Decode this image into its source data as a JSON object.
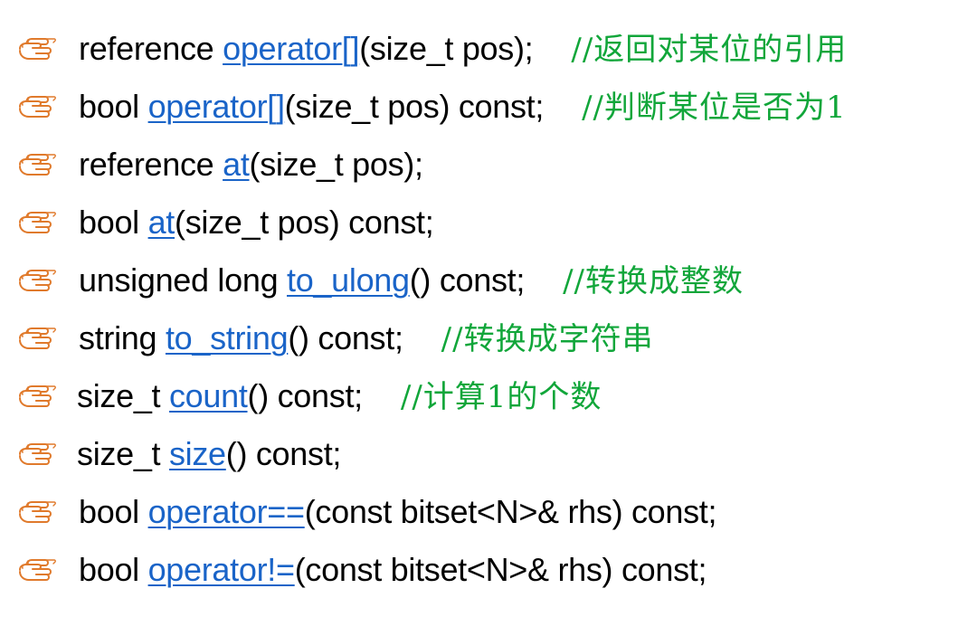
{
  "colors": {
    "text": "#000000",
    "link": "#1a64c8",
    "comment": "#11a63a",
    "bullet": "#e07a2c"
  },
  "bullet_icon": "pointing-hand-icon",
  "items": [
    {
      "prefix": "reference ",
      "link": "operator[]",
      "suffix": "(size_t pos);",
      "comment": "//返回对某位的引用"
    },
    {
      "prefix": "bool ",
      "link": "operator[]",
      "suffix": "(size_t pos) const;",
      "comment": "//判断某位是否为1"
    },
    {
      "prefix": "reference ",
      "link": "at",
      "suffix": "(size_t pos);",
      "comment": ""
    },
    {
      "prefix": "bool ",
      "link": "at",
      "suffix": "(size_t pos) const;",
      "comment": ""
    },
    {
      "prefix": "unsigned long ",
      "link": "to_ulong",
      "suffix": "() const;",
      "comment": "//转换成整数"
    },
    {
      "prefix": "string ",
      "link": "to_string",
      "suffix": "() const;",
      "comment": "//转换成字符串"
    },
    {
      "prefix": "size_t ",
      "link": "count",
      "suffix": "() const;",
      "comment": "//计算1的个数"
    },
    {
      "prefix": "size_t ",
      "link": "size",
      "suffix": "() const;",
      "comment": ""
    },
    {
      "prefix": "bool ",
      "link": "operator==",
      "suffix": "(const bitset<N>& rhs) const;",
      "comment": ""
    },
    {
      "prefix": "bool ",
      "link": "operator!=",
      "suffix": "(const bitset<N>& rhs) const;",
      "comment": ""
    }
  ]
}
